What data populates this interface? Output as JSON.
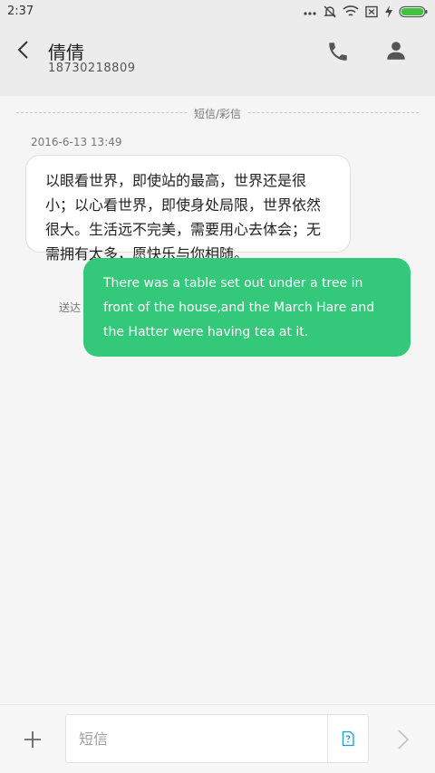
{
  "status_bar": {
    "time": "2:37"
  },
  "header": {
    "contact_name": "倩倩",
    "contact_number": "18730218809"
  },
  "conversation": {
    "divider_label": "短信/彩信",
    "timestamp": "2016-6-13 13:49",
    "incoming_message": "以眼看世界，即使站的最高，世界还是很小；以心看世界，即使身处局限，世界依然很大。生活远不完美，需要用心去体会；无需拥有太多，愿快乐与你相随。",
    "sent_status": "送达",
    "outgoing_message": "There was a table set out under a tree in front of the house,and the March Hare and the Hatter were having tea at it."
  },
  "compose": {
    "placeholder": "短信"
  },
  "icons": {
    "back": "back-arrow-icon",
    "phone": "phone-icon",
    "contact": "person-icon",
    "add": "plus-icon",
    "sim": "sim-card-icon",
    "send": "send-arrow-icon"
  },
  "colors": {
    "outgoing_bubble": "#34c97a",
    "header_background": "#ececec",
    "background": "#f5f5f5",
    "battery": "#3fc43f"
  }
}
